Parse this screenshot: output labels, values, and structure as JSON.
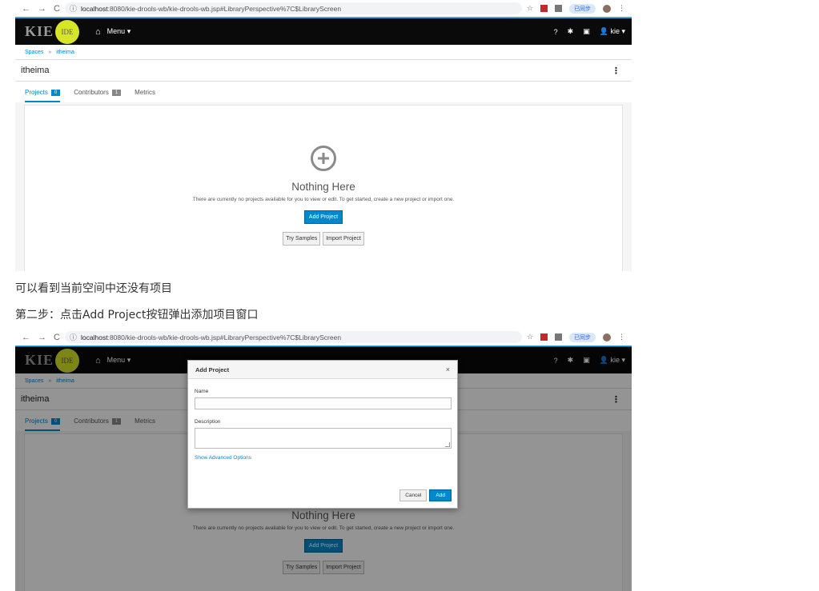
{
  "browser": {
    "url_host": "localhost",
    "url_rest": ":8080/kie-drools-wb/kie-drools-wb.jsp#LibraryPerspective%7C$LibraryScreen",
    "ext_label": "已同步"
  },
  "app": {
    "brand": "KIE",
    "brand_badge": "IDE",
    "menu": "Menu",
    "user": "kie"
  },
  "breadcrumb": {
    "spaces": "Spaces",
    "current": "itheima"
  },
  "space_title": "itheima",
  "tabs": [
    {
      "label": "Projects",
      "count": "0"
    },
    {
      "label": "Contributors",
      "count": "1"
    },
    {
      "label": "Metrics"
    }
  ],
  "empty_state": {
    "title": "Nothing Here",
    "subtitle": "There are currently no projects available for you to view or edit. To get started, create a new project or import one.",
    "add_project": "Add Project",
    "try_samples": "Try Samples",
    "import_project": "Import Project"
  },
  "captions": {
    "first": "可以看到当前空间中还没有项目",
    "second": "第二步：点击Add Project按钮弹出添加项目窗口"
  },
  "modal": {
    "title": "Add Project",
    "close": "×",
    "name_label": "Name",
    "description_label": "Description",
    "advanced_link": "Show Advanced Options",
    "cancel": "Cancel",
    "add": "Add"
  },
  "colors": {
    "accent": "#0088ce",
    "nav_bg": "#0a0a0a",
    "brand_badge": "#d6e626"
  }
}
